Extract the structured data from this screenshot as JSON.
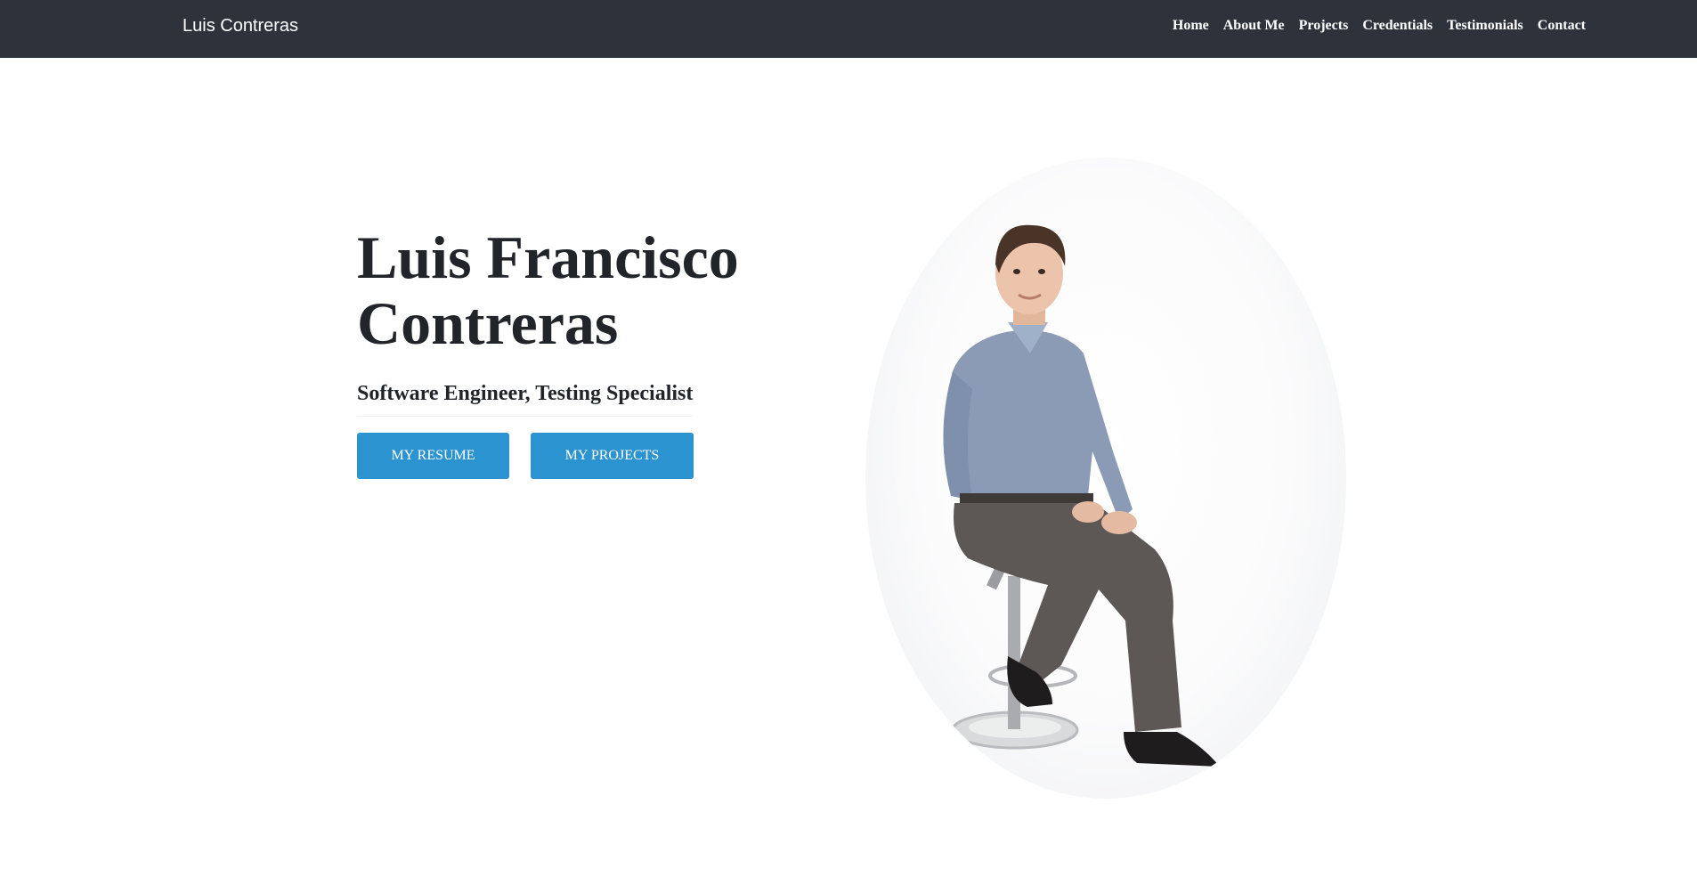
{
  "navbar": {
    "brand": "Luis Contreras",
    "links": [
      "Home",
      "About Me",
      "Projects",
      "Credentials",
      "Testimonials",
      "Contact"
    ]
  },
  "hero": {
    "title_line1": "Luis Francisco",
    "title_line2": "Contreras",
    "subtitle": "Software Engineer, Testing Specialist",
    "buttons": {
      "resume": "MY RESUME",
      "projects": "MY PROJECTS"
    },
    "portrait_icon": "person-photo"
  },
  "colors": {
    "navbar_bg": "#2e333b",
    "accent": "#2b93cf",
    "text": "#212529"
  }
}
